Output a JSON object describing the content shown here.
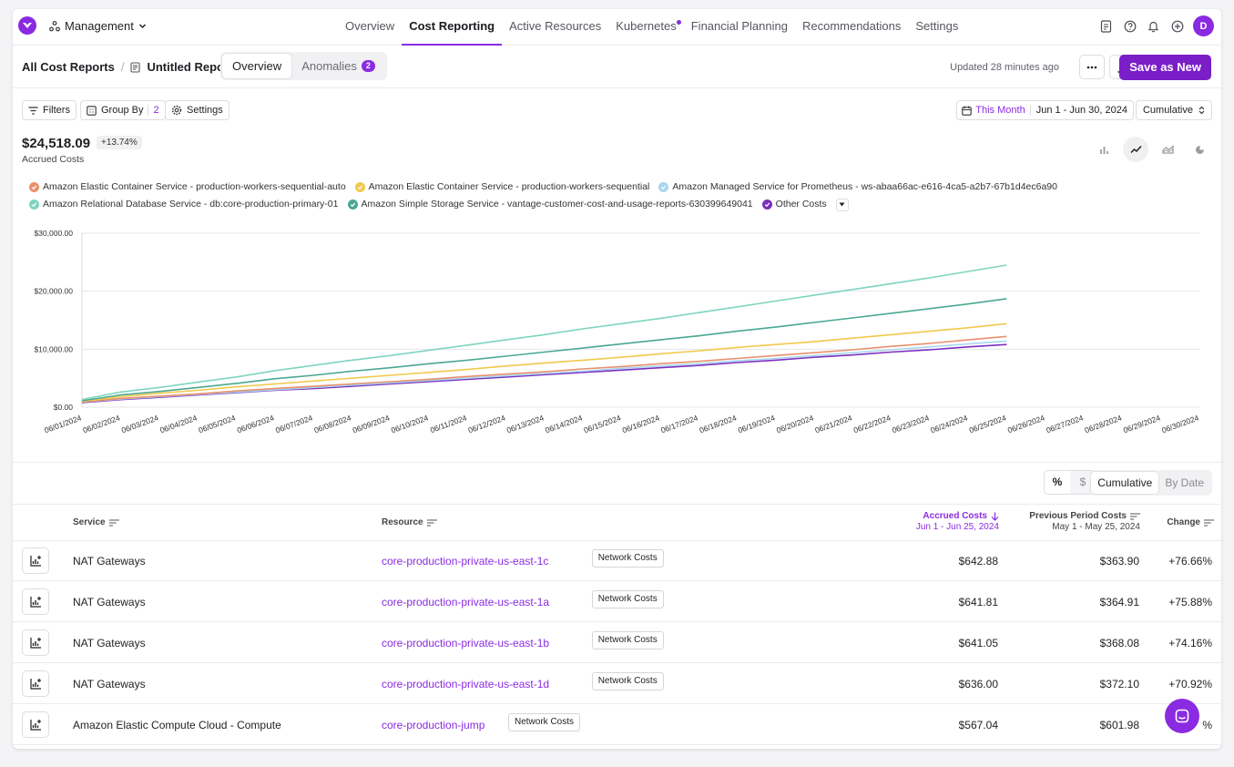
{
  "nav": {
    "workspace": "Management",
    "links": [
      "Overview",
      "Cost Reporting",
      "Active Resources",
      "Kubernetes",
      "Financial Planning",
      "Recommendations",
      "Settings"
    ],
    "active": "Cost Reporting",
    "avatar": "D"
  },
  "header": {
    "crumb_root": "All Cost Reports",
    "crumb_sep": "/",
    "report_name": "Untitled Report",
    "tab_overview": "Overview",
    "tab_anomalies": "Anomalies",
    "anomaly_count": "2",
    "updated": "Updated 28 minutes ago",
    "save_label": "Save as New"
  },
  "filters": {
    "filters_label": "Filters",
    "groupby_label": "Group By",
    "groupby_count": "2",
    "settings_label": "Settings",
    "date_preset": "This Month",
    "date_range": "Jun 1 - Jun 30, 2024",
    "mode": "Cumulative"
  },
  "summary": {
    "total": "$24,518.09",
    "delta": "+13.74%",
    "label": "Accrued Costs"
  },
  "legend": [
    {
      "name": "Amazon Elastic Container Service - production-workers-sequential-auto",
      "color": "#e8906e"
    },
    {
      "name": "Amazon Elastic Container Service - production-workers-sequential",
      "color": "#f2c94c"
    },
    {
      "name": "Amazon Managed Service for Prometheus - ws-abaa66ac-e616-4ca5-a2b7-67b1d4ec6a90",
      "color": "#a9d6f0"
    },
    {
      "name": "Amazon Relational Database Service - db:core-production-primary-01",
      "color": "#7fd4c0"
    },
    {
      "name": "Amazon Simple Storage Service - vantage-customer-cost-and-usage-reports-630399649041",
      "color": "#4aa892"
    },
    {
      "name": "Other Costs",
      "color": "#7b2fbf"
    }
  ],
  "chart_data": {
    "type": "line",
    "ylim": [
      0,
      30000
    ],
    "yticks": [
      "$30,000.00",
      "$20,000.00",
      "$10,000.00",
      "$0.00"
    ],
    "x": [
      "06/01/2024",
      "06/02/2024",
      "06/03/2024",
      "06/04/2024",
      "06/05/2024",
      "06/06/2024",
      "06/07/2024",
      "06/08/2024",
      "06/09/2024",
      "06/10/2024",
      "06/11/2024",
      "06/12/2024",
      "06/13/2024",
      "06/14/2024",
      "06/15/2024",
      "06/16/2024",
      "06/17/2024",
      "06/18/2024",
      "06/19/2024",
      "06/20/2024",
      "06/21/2024",
      "06/22/2024",
      "06/23/2024",
      "06/24/2024",
      "06/25/2024",
      "06/26/2024",
      "06/27/2024",
      "06/28/2024",
      "06/29/2024",
      "06/30/2024"
    ],
    "series": [
      {
        "color": "#7fd4c0",
        "values": [
          1300,
          2600,
          3400,
          4300,
          5200,
          6300,
          7200,
          8100,
          8900,
          9800,
          10700,
          11600,
          12500,
          13500,
          14400,
          15300,
          16300,
          17300,
          18300,
          19300,
          20300,
          21300,
          22300,
          23400,
          24500
        ]
      },
      {
        "color": "#4aa892",
        "values": [
          1100,
          2100,
          2700,
          3400,
          4100,
          4900,
          5500,
          6200,
          6800,
          7500,
          8100,
          8800,
          9500,
          10200,
          10900,
          11600,
          12300,
          13100,
          13800,
          14600,
          15400,
          16200,
          17000,
          17800,
          18700
        ]
      },
      {
        "color": "#f2c94c",
        "values": [
          1000,
          1800,
          2400,
          2900,
          3500,
          4000,
          4500,
          5000,
          5500,
          6000,
          6500,
          7100,
          7600,
          8100,
          8600,
          9200,
          9700,
          10300,
          10800,
          11300,
          11900,
          12500,
          13100,
          13700,
          14400
        ]
      },
      {
        "color": "#e8906e",
        "values": [
          900,
          1500,
          1900,
          2300,
          2800,
          3200,
          3600,
          4000,
          4400,
          4800,
          5300,
          5700,
          6100,
          6600,
          7000,
          7500,
          7900,
          8400,
          8900,
          9400,
          9900,
          10500,
          11000,
          11600,
          12200
        ]
      },
      {
        "color": "#a9d6f0",
        "values": [
          900,
          1400,
          1800,
          2200,
          2600,
          3000,
          3400,
          3800,
          4200,
          4600,
          5000,
          5400,
          5800,
          6200,
          6700,
          7100,
          7500,
          8000,
          8400,
          8900,
          9400,
          9900,
          10400,
          10900,
          11400
        ]
      },
      {
        "color": "#7b2fbf",
        "values": [
          800,
          1300,
          1700,
          2100,
          2500,
          2900,
          3200,
          3600,
          4000,
          4400,
          4800,
          5200,
          5600,
          6000,
          6400,
          6800,
          7200,
          7700,
          8100,
          8600,
          9000,
          9500,
          9900,
          10400,
          10800
        ]
      }
    ]
  },
  "table": {
    "pct": "%",
    "dollar": "$",
    "cumulative": "Cumulative",
    "bydate": "By Date",
    "headers": {
      "service": "Service",
      "resource": "Resource",
      "accrued": "Accrued Costs",
      "accrued_range": "Jun 1 - Jun 25, 2024",
      "previous": "Previous Period Costs",
      "previous_range": "May 1 - May 25, 2024",
      "change": "Change"
    },
    "rows": [
      {
        "service": "NAT Gateways",
        "resource": "core-production-private-us-east-1c",
        "tag": "Network Costs",
        "accrued": "$642.88",
        "previous": "$363.90",
        "change": "+76.66%"
      },
      {
        "service": "NAT Gateways",
        "resource": "core-production-private-us-east-1a",
        "tag": "Network Costs",
        "accrued": "$641.81",
        "previous": "$364.91",
        "change": "+75.88%"
      },
      {
        "service": "NAT Gateways",
        "resource": "core-production-private-us-east-1b",
        "tag": "Network Costs",
        "accrued": "$641.05",
        "previous": "$368.08",
        "change": "+74.16%"
      },
      {
        "service": "NAT Gateways",
        "resource": "core-production-private-us-east-1d",
        "tag": "Network Costs",
        "accrued": "$636.00",
        "previous": "$372.10",
        "change": "+70.92%"
      },
      {
        "service": "Amazon Elastic Compute Cloud - Compute",
        "resource": "core-production-jump",
        "tag": "Network Costs",
        "accrued": "$567.04",
        "previous": "$601.98",
        "change": "%"
      }
    ]
  }
}
